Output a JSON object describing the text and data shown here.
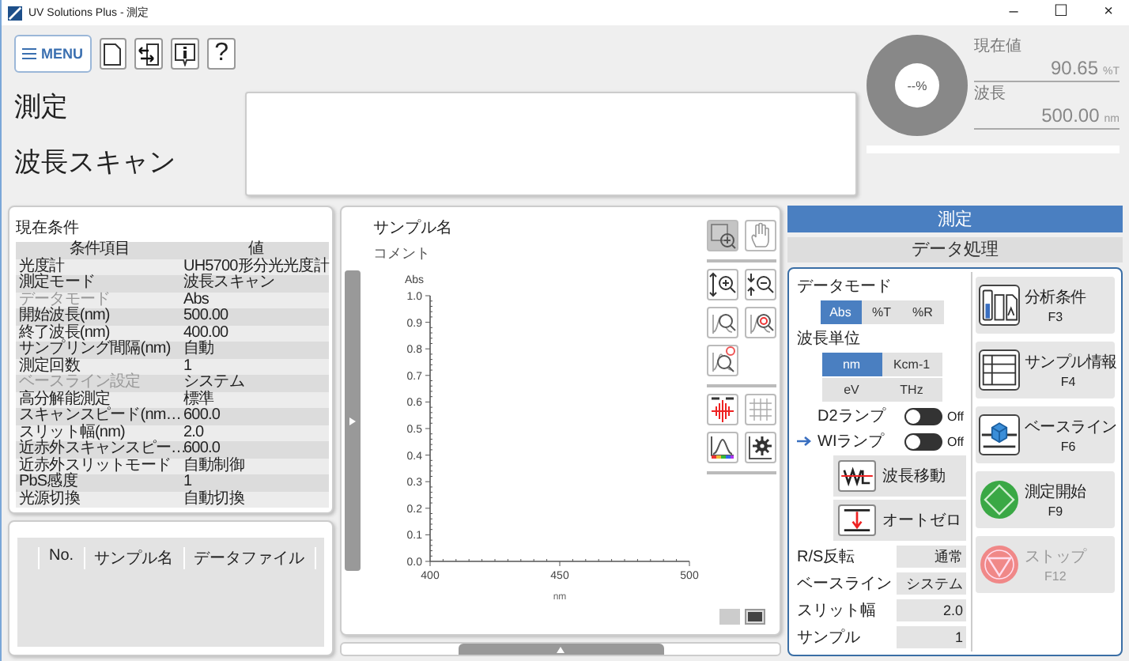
{
  "window": {
    "title": "UV Solutions Plus - 測定",
    "controls": [
      "–",
      "☐",
      "×"
    ]
  },
  "toolbar": {
    "menu_label": "MENU",
    "help_label": "?"
  },
  "header": {
    "mode": "測定",
    "measurement": "波長スキャン"
  },
  "monitor": {
    "gauge_text": "--%",
    "current_label": "現在値",
    "current_value": "90.65",
    "current_unit": "%T",
    "wavelength_label": "波長",
    "wavelength_value": "500.00",
    "wavelength_unit": "nm"
  },
  "conditions": {
    "title": "現在条件",
    "columns": [
      "条件項目",
      "値"
    ],
    "rows": [
      {
        "item": "光度計",
        "value": "UH5700形分光光度計",
        "disabled": false
      },
      {
        "item": "測定モード",
        "value": "波長スキャン",
        "disabled": false
      },
      {
        "item": "データモード",
        "value": "Abs",
        "disabled": true
      },
      {
        "item": "開始波長(nm)",
        "value": "500.00",
        "disabled": false
      },
      {
        "item": "終了波長(nm)",
        "value": "400.00",
        "disabled": false
      },
      {
        "item": "サンプリング間隔(nm)",
        "value": "自動",
        "disabled": false
      },
      {
        "item": "測定回数",
        "value": "1",
        "disabled": false
      },
      {
        "item": "ベースライン設定",
        "value": "システム",
        "disabled": true
      },
      {
        "item": "高分解能測定",
        "value": "標準",
        "disabled": false
      },
      {
        "item": "スキャンスピード(nm…",
        "value": "600.0",
        "disabled": false
      },
      {
        "item": "スリット幅(nm)",
        "value": "2.0",
        "disabled": false
      },
      {
        "item": "近赤外スキャンスピー…",
        "value": "600.0",
        "disabled": false
      },
      {
        "item": "近赤外スリットモード",
        "value": "自動制御",
        "disabled": false
      },
      {
        "item": "PbS感度",
        "value": "1",
        "disabled": false
      },
      {
        "item": "光源切換",
        "value": "自動切換",
        "disabled": false
      }
    ]
  },
  "samples": {
    "columns": [
      "No.",
      "サンプル名",
      "データファイル"
    ]
  },
  "chart_panel": {
    "sample_name": "サンプル名",
    "comment": "コメント",
    "chart_data": {
      "type": "line",
      "xlabel": "nm",
      "ylabel": "Abs",
      "xlim": [
        400,
        500
      ],
      "ylim": [
        0,
        1
      ],
      "xticks": [
        400,
        450,
        500
      ],
      "yticks": [
        {
          "value": 0,
          "label": "0.0"
        },
        {
          "value": 0.1,
          "label": "0.1"
        },
        {
          "value": 0.2,
          "label": "0.2"
        },
        {
          "value": 0.3,
          "label": "0.3"
        },
        {
          "value": 0.4,
          "label": "0.4"
        },
        {
          "value": 0.5,
          "label": "0.5"
        },
        {
          "value": 0.6,
          "label": "0.6"
        },
        {
          "value": 0.7,
          "label": "0.7"
        },
        {
          "value": 0.8,
          "label": "0.8"
        },
        {
          "value": 0.9,
          "label": "0.9"
        },
        {
          "value": 1,
          "label": "1.0"
        }
      ]
    },
    "tool_groups": [
      {
        "tools": [
          {
            "kind": "zoom-area",
            "selected": true
          },
          {
            "kind": "pan",
            "selected": false
          }
        ]
      },
      {
        "tools": [
          {
            "kind": "zoom-in",
            "selected": false
          },
          {
            "kind": "zoom-out",
            "selected": false
          },
          {
            "kind": "auto-scale",
            "selected": false
          },
          {
            "kind": "auto-scale-target",
            "selected": false
          },
          {
            "kind": "auto-scale-timer",
            "selected": false
          }
        ]
      },
      {
        "tools": [
          {
            "kind": "peak",
            "selected": false
          },
          {
            "kind": "grid",
            "selected": false
          },
          {
            "kind": "spectrum",
            "selected": false
          },
          {
            "kind": "settings",
            "selected": false
          }
        ]
      }
    ],
    "view_buttons": [
      {
        "selected": false
      },
      {
        "selected": true
      }
    ]
  },
  "tabs": [
    {
      "label": "測定",
      "selected": true
    },
    {
      "label": "データ処理",
      "selected": false
    }
  ],
  "data_mode": {
    "label": "データモード",
    "options": [
      {
        "label": "Abs",
        "selected": true
      },
      {
        "label": "%T",
        "selected": false
      },
      {
        "label": "%R",
        "selected": false
      }
    ]
  },
  "wavelength_unit": {
    "label": "波長単位",
    "options": [
      {
        "label": "nm",
        "selected": true
      },
      {
        "label": "Kcm-1",
        "selected": false
      },
      {
        "label": "eV",
        "selected": false
      },
      {
        "label": "THz",
        "selected": false
      }
    ]
  },
  "lamps": [
    {
      "label": "D2ランプ",
      "on": false,
      "state": "Off",
      "active": false
    },
    {
      "label": "WIランプ",
      "on": false,
      "state": "Off",
      "active": true
    }
  ],
  "actions": [
    {
      "kind": "wavelength-move",
      "label": "波長移動"
    },
    {
      "kind": "autozero",
      "label": "オートゼロ"
    }
  ],
  "settings": [
    {
      "label": "R/S反転",
      "value": "通常"
    },
    {
      "label": "ベースライン",
      "value": "システム"
    },
    {
      "label": "スリット幅",
      "value": "2.0"
    },
    {
      "label": "サンプル",
      "value": "1"
    }
  ],
  "functions": [
    {
      "kind": "conditions",
      "label": "分析条件",
      "key": "F3",
      "disabled": false
    },
    {
      "kind": "sample-info",
      "label": "サンプル情報",
      "key": "F4",
      "disabled": false
    },
    {
      "kind": "baseline",
      "label": "ベースライン",
      "key": "F6",
      "disabled": false
    },
    {
      "kind": "start",
      "label": "測定開始",
      "key": "F9",
      "disabled": false
    },
    {
      "kind": "stop",
      "label": "ストップ",
      "key": "F12",
      "disabled": true
    }
  ]
}
